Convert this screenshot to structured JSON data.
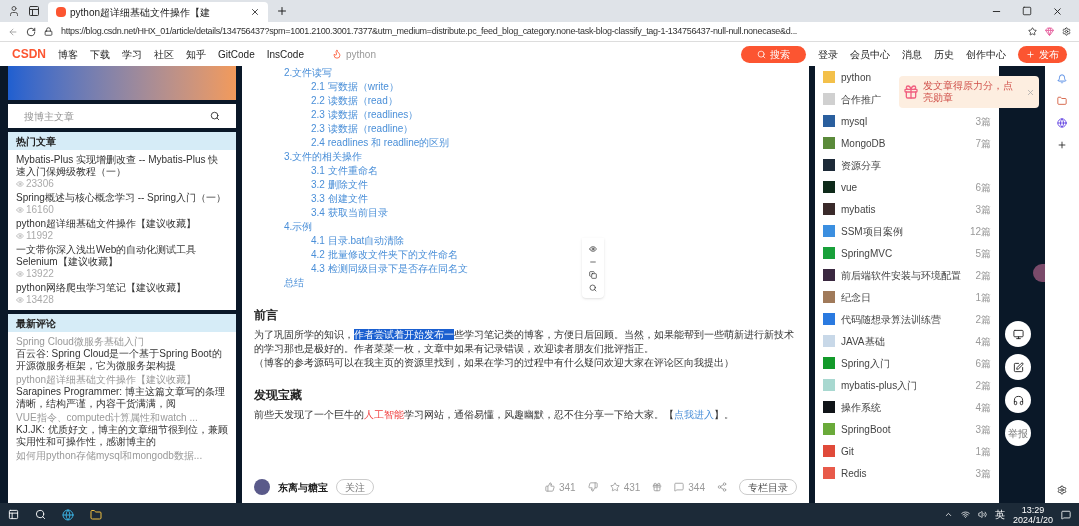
{
  "browser": {
    "tab_title": "python超详细基础文件操作【建",
    "url": "https://blog.csdn.net/HHX_01/article/details/134756437?spm=1001.2100.3001.7377&utm_medium=distribute.pc_feed_blog_category.none-task-blog-classify_tag-1-134756437-null-null.nonecase&d..."
  },
  "nav": {
    "logo": "CSDN",
    "links": [
      "博客",
      "下载",
      "学习",
      "社区",
      "知乎",
      "GitCode",
      "InsCode"
    ],
    "search_hint": "python",
    "search_button": "搜索",
    "right_links": [
      "登录",
      "会员中心",
      "消息",
      "历史",
      "创作中心"
    ],
    "publish": "发布"
  },
  "left": {
    "search": {
      "placeholder": "搜博主文章"
    },
    "hot": {
      "title": "热门文章",
      "items": [
        {
          "title": "Mybatis-Plus 实现增删改查 -- Mybatis-Plus 快速入门保姆级教程（一）",
          "views": "23306"
        },
        {
          "title": "Spring概述与核心概念学习 -- Spring入门（一）",
          "views": "16160"
        },
        {
          "title": "python超详细基础文件操作【建议收藏】",
          "views": "11992"
        },
        {
          "title": "一文带你深入浅出Web的自动化测试工具Selenium【建议收藏】",
          "views": "13922"
        },
        {
          "title": "python网络爬虫学习笔记【建议收藏】",
          "views": "13428"
        }
      ]
    },
    "comments": {
      "title": "最新评论",
      "items": [
        {
          "article": "Spring Cloud微服务基础入门",
          "text": "百云谷: Spring Cloud是一个基于Spring Boot的开源微服务框架，它为微服务架构提"
        },
        {
          "article": "python超详细基础文件操作【建议收藏】",
          "text": "Sarapines Programmer: 博主这篇文章写的条理清晰，结构严谨，内容干货满满，阅"
        },
        {
          "article": "VUE指令、computed计算属性和watch ...",
          "text": "KJ.JK: 优质好文，博主的文章细节很到位，兼顾实用性和可操作性，感谢博主的"
        },
        {
          "article": "如何用python存储mysql和mongodb数据..."
        }
      ]
    }
  },
  "article": {
    "toc": [
      {
        "label": "2.文件读写",
        "children": [
          {
            "label": "2.1 写数据（write）"
          },
          {
            "label": "2.2 读数据（read）"
          },
          {
            "label": "2.3 读数据（readlines）"
          },
          {
            "label": "2.3 读数据（readline）"
          },
          {
            "label": "2.4 readlines 和 readline的区别"
          }
        ]
      },
      {
        "label": "3.文件的相关操作",
        "children": [
          {
            "label": "3.1 文件重命名"
          },
          {
            "label": "3.2 删除文件"
          },
          {
            "label": "3.3 创建文件"
          },
          {
            "label": "3.4 获取当前目录"
          }
        ]
      },
      {
        "label": "4.示例",
        "children": [
          {
            "label": "4.1 目录.bat自动清除"
          },
          {
            "label": "4.2 批量修改文件夹下的文件命名"
          },
          {
            "label": "4.3 检测同级目录下是否存在同名文"
          }
        ]
      },
      {
        "label": "总结"
      }
    ],
    "sections": [
      {
        "heading": "前言",
        "paragraphs": [
          [
            {
              "kind": "text",
              "text": "为了巩固所学的知识，",
              "selected": false
            },
            {
              "kind": "text",
              "text": "作者尝试着开始发布一",
              "selected": true
            },
            {
              "kind": "text",
              "text": "些学习笔记类的博客，方便日后回顾。当然，如果能帮到一些萌新进行新技术的学习那也是极好的。作者菜菜一枚，文章中如果有记录错误，欢迎读者朋友们批评指正。",
              "selected": false
            }
          ],
          [
            {
              "kind": "text",
              "text": "（博客的参考源码可以在我主页的资源里找到，如果在学习的过程中有什么疑问欢迎大家在评论区向我提出）",
              "selected": false
            }
          ]
        ]
      },
      {
        "heading": "发现宝藏",
        "paragraphs": [
          [
            {
              "kind": "text",
              "text": "前些天发现了一个巨牛的",
              "selected": false
            },
            {
              "kind": "highlight",
              "text": "人工智能",
              "selected": false
            },
            {
              "kind": "text",
              "text": "学习网站，通俗易懂，风趣幽默，忍不住分享一下给大家。【",
              "selected": false
            },
            {
              "kind": "link",
              "text": "点我进入",
              "selected": false
            },
            {
              "kind": "text",
              "text": "】。",
              "selected": false
            }
          ]
        ]
      }
    ],
    "footer": {
      "author": "东离与糖宝",
      "follow": "关注",
      "likes": "341",
      "stars": "431",
      "comments": "344",
      "column": "专栏目录"
    }
  },
  "categories": [
    {
      "name": "python",
      "color": "#f3c04a"
    },
    {
      "name": "合作推广",
      "color": "#d0d0d0"
    },
    {
      "name": "mysql",
      "count": "3篇",
      "color": "#2a5f9e"
    },
    {
      "name": "MongoDB",
      "count": "7篇",
      "color": "#5a8a3a"
    },
    {
      "name": "资源分享",
      "color": "#1d2a38"
    },
    {
      "name": "vue",
      "count": "6篇",
      "color": "#0e2a1a"
    },
    {
      "name": "mybatis",
      "count": "3篇",
      "color": "#3a2a2a"
    },
    {
      "name": "SSM项目案例",
      "count": "12篇",
      "color": "#3b8fe0"
    },
    {
      "name": "SpringMVC",
      "count": "5篇",
      "color": "#18a03a"
    },
    {
      "name": "前后端软件安装与环境配置",
      "count": "2篇",
      "color": "#3a2840"
    },
    {
      "name": "纪念日",
      "count": "1篇",
      "color": "#a07a5a"
    },
    {
      "name": "代码随想录算法训练营",
      "count": "2篇",
      "color": "#2a7ae0"
    },
    {
      "name": "JAVA基础",
      "count": "4篇",
      "color": "#c8d8e8"
    },
    {
      "name": "Spring入门",
      "count": "6篇",
      "color": "#129a2a"
    },
    {
      "name": "mybatis-plus入门",
      "count": "2篇",
      "color": "#a8d8d0"
    },
    {
      "name": "操作系统",
      "count": "4篇",
      "color": "#101418"
    },
    {
      "name": "SpringBoot",
      "count": "3篇",
      "color": "#6aaa3a"
    },
    {
      "name": "Git",
      "count": "1篇",
      "color": "#e04a3a"
    },
    {
      "name": "Redis",
      "count": "3篇",
      "color": "#e85a4a"
    }
  ],
  "promo": {
    "text": "发文章得原力分，点亮勋章"
  },
  "float_buttons": {
    "report": "举报"
  },
  "taskbar": {
    "ime": "英",
    "time": "13:29",
    "date": "2024/1/20"
  }
}
